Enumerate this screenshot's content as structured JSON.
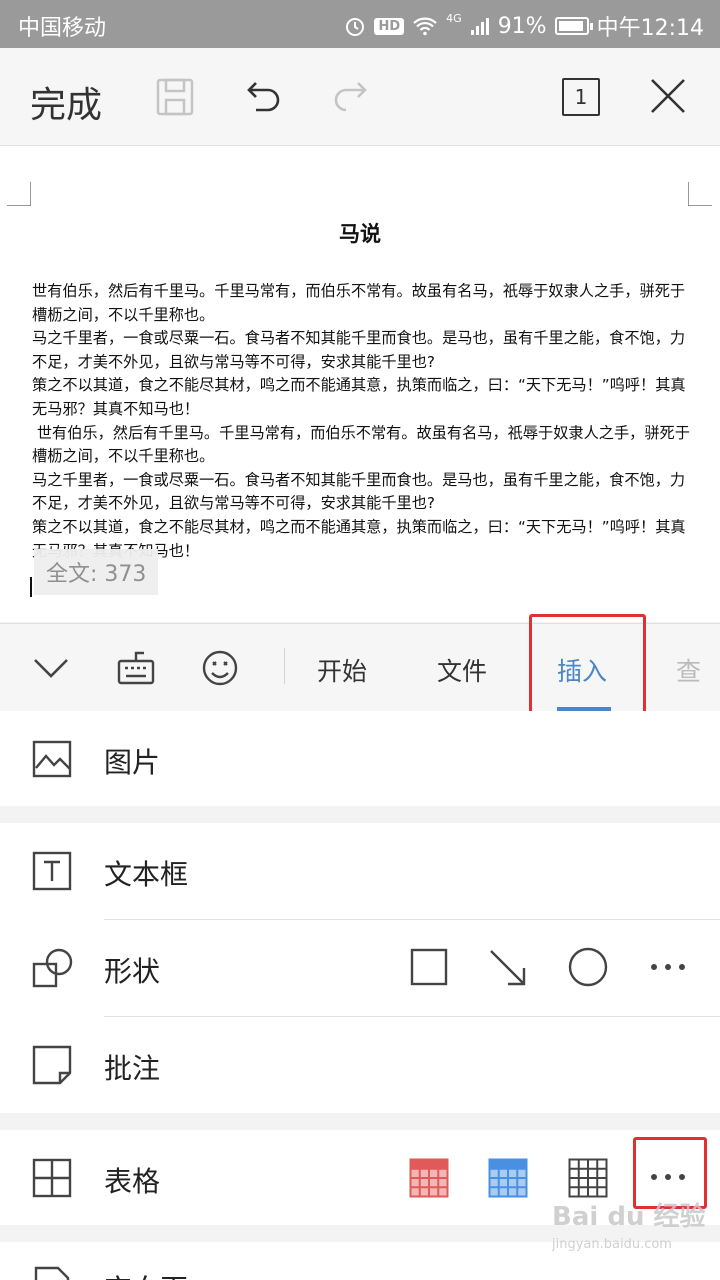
{
  "status_bar": {
    "carrier": "中国移动",
    "hd": "HD",
    "network": "4G",
    "battery": "91%",
    "battery_level": 0.91,
    "time": "中午12:14"
  },
  "toolbar": {
    "done_label": "完成",
    "page_count": "1"
  },
  "document": {
    "title": "马说",
    "paragraphs": [
      "世有伯乐，然后有千里马。千里马常有，而伯乐不常有。故虽有名马，祇辱于奴隶人之手，骈死于槽枥之间，不以千里称也。",
      "马之千里者，一食或尽粟一石。食马者不知其能千里而食也。是马也，虽有千里之能，食不饱，力不足，才美不外见，且欲与常马等不可得，安求其能千里也?",
      "策之不以其道，食之不能尽其材，鸣之而不能通其意，执策而临之，曰：“天下无马！”呜呼！其真无马邪？其真不知马也！",
      " 世有伯乐，然后有千里马。千里马常有，而伯乐不常有。故虽有名马，祇辱于奴隶人之手，骈死于槽枥之间，不以千里称也。",
      "马之千里者，一食或尽粟一石。食马者不知其能千里而食也。是马也，虽有千里之能，食不饱，力不足，才美不外见，且欲与常马等不可得，安求其能千里也?",
      "策之不以其道，食之不能尽其材，鸣之而不能通其意，执策而临之，曰：“天下无马！”呜呼！其真无马邪？其真不知马也！"
    ],
    "word_count": "全文: 373"
  },
  "tabs": {
    "start": "开始",
    "file": "文件",
    "insert": "插入",
    "next_partial": "查"
  },
  "insert_panel": {
    "picture": "图片",
    "textbox": "文本框",
    "shape": "形状",
    "comment": "批注",
    "table": "表格",
    "next_partial": "空白页"
  },
  "watermark": {
    "brand": "Bai du 经验",
    "url": "jingyan.baidu.com"
  },
  "colors": {
    "accent": "#4a86c8",
    "highlight_box": "#e03030",
    "table_red": "#e05a5a",
    "table_blue": "#4a90e2"
  }
}
